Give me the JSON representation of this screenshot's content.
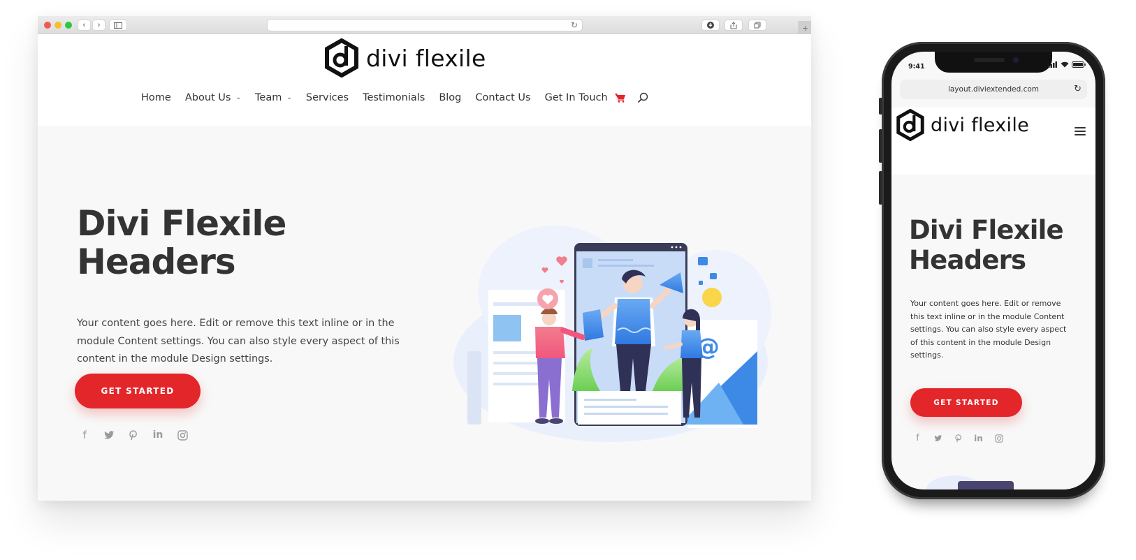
{
  "browser": {
    "traffic_lights": {
      "close": "#f15a55",
      "minimize": "#f6be30",
      "maximize": "#2ec840"
    },
    "toolbar_icons": [
      "back-icon",
      "forward-icon",
      "sidebar-icon",
      "reload-icon",
      "download-icon",
      "share-icon",
      "tabs-icon",
      "new-tab-icon"
    ],
    "address_value": "",
    "glyphs": {
      "back": "‹",
      "forward": "›",
      "reload": "↻",
      "plus": "+"
    }
  },
  "site": {
    "logo_text": "divi flexile",
    "nav": [
      {
        "label": "Home",
        "has_dropdown": false
      },
      {
        "label": "About Us",
        "has_dropdown": true
      },
      {
        "label": "Team",
        "has_dropdown": true
      },
      {
        "label": "Services",
        "has_dropdown": false
      },
      {
        "label": "Testimonials",
        "has_dropdown": false
      },
      {
        "label": "Blog",
        "has_dropdown": false
      },
      {
        "label": "Contact Us",
        "has_dropdown": false
      },
      {
        "label": "Get In Touch",
        "has_dropdown": false
      }
    ],
    "chevron": "⌄",
    "hero": {
      "title_line1": "Divi Flexile",
      "title_line2": "Headers",
      "body": "Your content goes here. Edit or remove this text inline or in the module Content settings. You can also style every aspect of this content in the module Design settings.",
      "cta_label": "GET STARTED"
    },
    "social": [
      {
        "name": "facebook",
        "glyph": "f"
      },
      {
        "name": "twitter",
        "glyph": "t"
      },
      {
        "name": "pinterest",
        "glyph": "p"
      },
      {
        "name": "linkedin",
        "glyph": "in"
      },
      {
        "name": "instagram",
        "glyph": "ig"
      }
    ],
    "colors": {
      "accent": "#e2262a",
      "heading": "#333333",
      "text": "#444444",
      "background": "#f8f8f8",
      "social_icon": "#9a9a9a"
    }
  },
  "phone": {
    "status_time": "9:41",
    "url": "layout.diviextended.com",
    "logo_text": "divi flexile",
    "hero": {
      "title_line1": "Divi Flexile",
      "title_line2": "Headers",
      "body": "Your content goes here. Edit or remove this text inline or in the module Content settings. You can also style every aspect of this content in the module Design settings.",
      "cta_label": "GET STARTED"
    }
  }
}
